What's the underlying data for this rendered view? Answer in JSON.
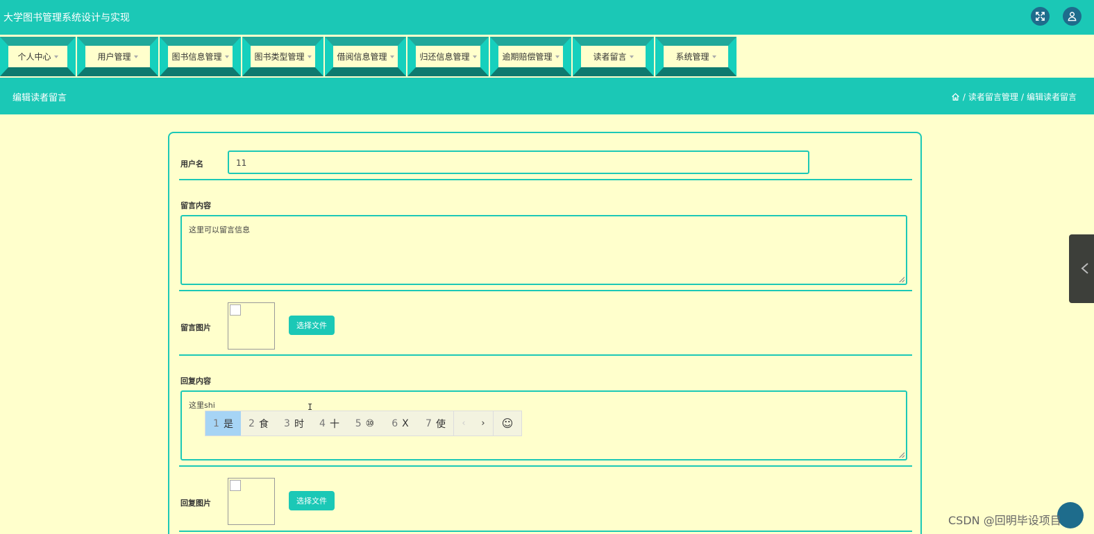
{
  "app": {
    "title": "大学图书管理系统设计与实现"
  },
  "topbar_icons": [
    "fullscreen-icon",
    "user-icon"
  ],
  "nav": {
    "items": [
      {
        "label": "个人中心"
      },
      {
        "label": "用户管理"
      },
      {
        "label": "图书信息管理"
      },
      {
        "label": "图书类型管理"
      },
      {
        "label": "借阅信息管理"
      },
      {
        "label": "归还信息管理"
      },
      {
        "label": "逾期赔偿管理"
      },
      {
        "label": "读者留言"
      },
      {
        "label": "系统管理"
      }
    ]
  },
  "header": {
    "page_title": "编辑读者留言",
    "breadcrumb": {
      "separator": "/",
      "items": [
        "读者留言管理",
        "编辑读者留言"
      ]
    }
  },
  "form": {
    "username": {
      "label": "用户名",
      "value": "11"
    },
    "message_content": {
      "label": "留言内容",
      "value": "这里可以留言信息"
    },
    "message_image": {
      "label": "留言图片",
      "button": "选择文件"
    },
    "reply_content": {
      "label": "回复内容",
      "value": "这里shi"
    },
    "reply_image": {
      "label": "回复图片",
      "button": "选择文件"
    }
  },
  "ime": {
    "candidates": [
      {
        "num": "1",
        "text": "是",
        "active": true
      },
      {
        "num": "2",
        "text": "食"
      },
      {
        "num": "3",
        "text": "时"
      },
      {
        "num": "4",
        "text": "十"
      },
      {
        "num": "5",
        "text": "⑩"
      },
      {
        "num": "6",
        "text": "X"
      },
      {
        "num": "7",
        "text": "使"
      }
    ],
    "prev": "‹",
    "next": "›",
    "emoji": "☺"
  },
  "text_cursor": "I",
  "watermark": "CSDN @回明毕设项目",
  "colors": {
    "accent": "#1bc8b6",
    "background": "#ffffcc",
    "icon_circle": "#1e6c8c"
  }
}
